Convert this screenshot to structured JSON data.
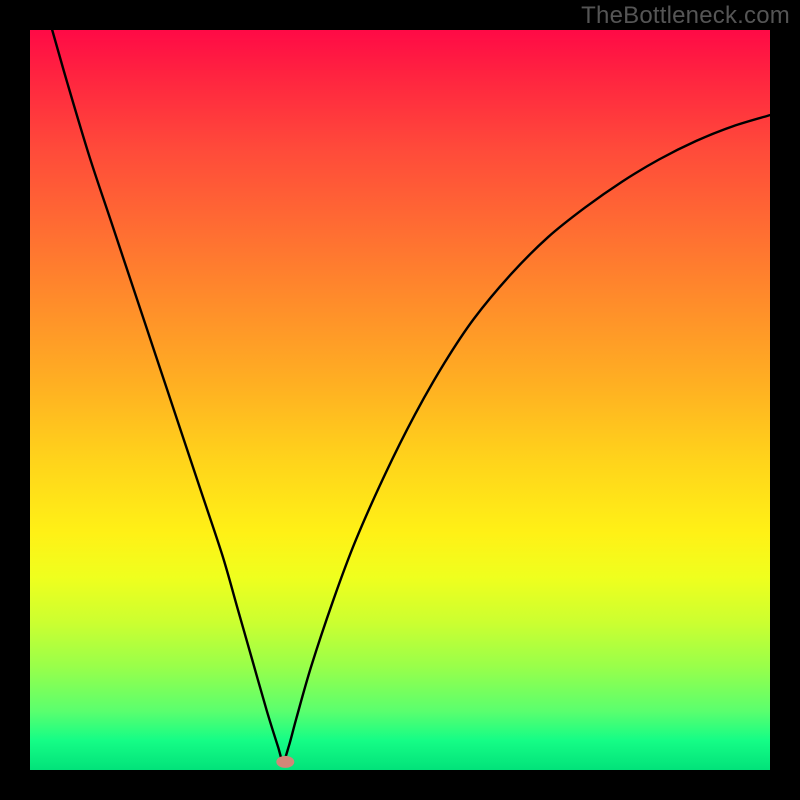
{
  "watermark": "TheBottleneck.com",
  "chart_data": {
    "type": "line",
    "title": "",
    "xlabel": "",
    "ylabel": "",
    "xlim": [
      0,
      100
    ],
    "ylim": [
      0,
      100
    ],
    "grid": false,
    "legend": false,
    "series": [
      {
        "name": "curve",
        "x": [
          3,
          5,
          8,
          11,
          14,
          17,
          20,
          23,
          26,
          28,
          30,
          32,
          33.5,
          34.2,
          35,
          36,
          38,
          41,
          44,
          48,
          52,
          56,
          60,
          65,
          70,
          75,
          80,
          85,
          90,
          95,
          100
        ],
        "y": [
          100,
          93,
          83,
          74,
          65,
          56,
          47,
          38,
          29,
          22,
          15,
          8,
          3.2,
          1.2,
          3.3,
          7,
          14,
          23,
          31,
          40,
          48,
          55,
          61,
          67,
          72,
          76,
          79.5,
          82.5,
          85,
          87,
          88.5
        ]
      }
    ],
    "marker": {
      "x": 34.5,
      "y": 1.1,
      "color": "#d08778"
    },
    "gradient_stops": [
      {
        "pos": 0,
        "color": "#ff0a46"
      },
      {
        "pos": 50,
        "color": "#ffd31b"
      },
      {
        "pos": 75,
        "color": "#efff1e"
      },
      {
        "pos": 100,
        "color": "#02e27a"
      }
    ]
  }
}
